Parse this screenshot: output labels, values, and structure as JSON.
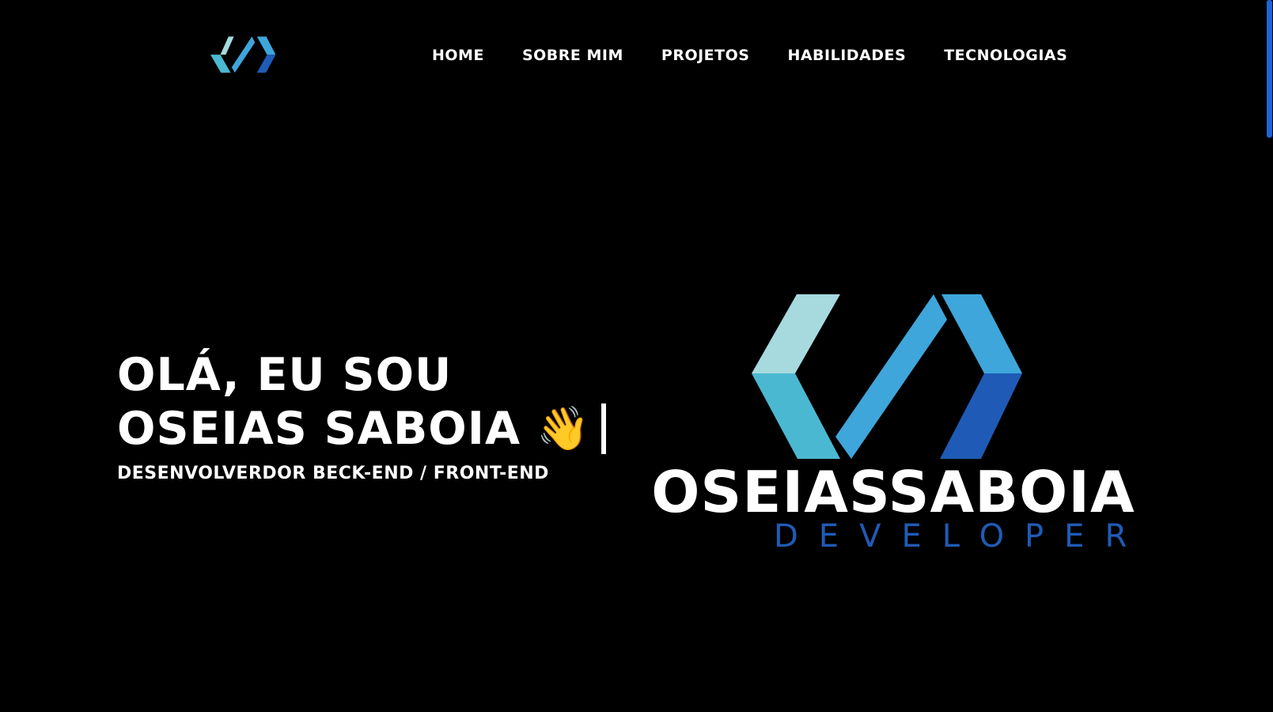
{
  "header": {
    "logo_icon": "code-brackets-icon",
    "nav": [
      {
        "label": "HOME"
      },
      {
        "label": "SOBRE MIM"
      },
      {
        "label": "PROJETOS"
      },
      {
        "label": "HABILIDADES"
      },
      {
        "label": "TECNOLOGIAS"
      }
    ]
  },
  "hero": {
    "line1": "OLÁ, EU SOU",
    "line2": "OSEIAS SABOIA",
    "wave_icon": "👋",
    "subtitle": "DESENVOLVERDOR BECK-END / FRONT-END"
  },
  "brand": {
    "name": "OSEIASSABOIA",
    "tagline": "DEVELOPER"
  },
  "colors": {
    "background": "#000000",
    "light_teal": "#a6dadf",
    "teal": "#4bb8d1",
    "blue": "#3ea6db",
    "dark_blue": "#1f5bb6"
  }
}
